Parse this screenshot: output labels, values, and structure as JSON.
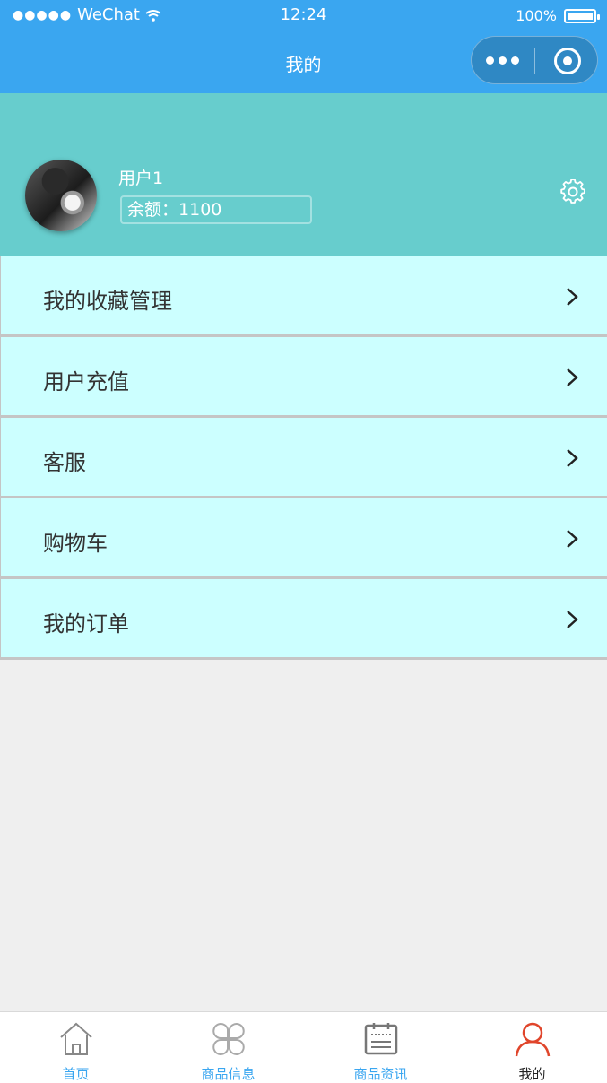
{
  "status_bar": {
    "signal": "●●●●●",
    "carrier": "WeChat",
    "time": "12:24",
    "battery_text": "100%"
  },
  "nav": {
    "title": "我的"
  },
  "profile": {
    "username": "用户1",
    "balance_label": "余额：",
    "balance_value": "1100"
  },
  "menu": {
    "items": [
      {
        "label": "我的收藏管理"
      },
      {
        "label": "用户充值"
      },
      {
        "label": "客服"
      },
      {
        "label": "购物车"
      },
      {
        "label": "我的订单"
      }
    ]
  },
  "tabbar": {
    "items": [
      {
        "label": "首页",
        "icon": "home-icon"
      },
      {
        "label": "商品信息",
        "icon": "clover-icon"
      },
      {
        "label": "商品资讯",
        "icon": "news-icon"
      },
      {
        "label": "我的",
        "icon": "user-icon"
      }
    ],
    "active_index": 3
  },
  "colors": {
    "primary_blue": "#3aa6f0",
    "profile_teal": "#67cdcd",
    "menu_bg": "#ccffff",
    "page_bg": "#efefef",
    "active_tab_icon": "#e0452b"
  }
}
